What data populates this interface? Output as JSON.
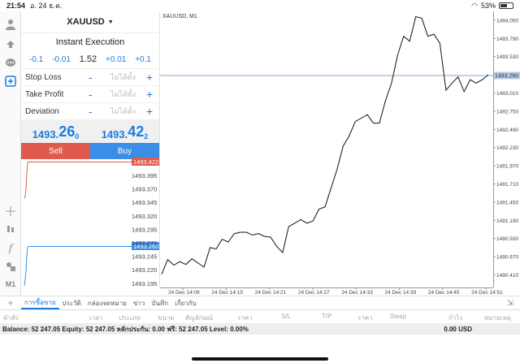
{
  "status_bar": {
    "time": "21:54",
    "date": "อ. 24 ธ.ค.",
    "battery": "53%"
  },
  "order": {
    "symbol": "XAUUSD",
    "execution": "Instant Execution",
    "volume": {
      "m1": "-0.1",
      "m2": "-0.01",
      "value": "1.52",
      "p1": "+0.01",
      "p2": "+0.1"
    },
    "stop_loss": {
      "label": "Stop Loss",
      "placeholder": "ไม่ได้ตั้ง"
    },
    "take_profit": {
      "label": "Take Profit",
      "placeholder": "ไม่ได้ตั้ง"
    },
    "deviation": {
      "label": "Deviation",
      "placeholder": "ไม่ได้ตั้ง"
    },
    "minus": "-",
    "plus": "+",
    "bid": {
      "small": "1493.",
      "big": "26",
      "sup": "0"
    },
    "ask": {
      "small": "1493.",
      "big": "42",
      "sup": "2"
    },
    "sell_label": "Sell",
    "buy_label": "Buy"
  },
  "mini_chart": {
    "ask_label": "1493.422",
    "bid_label": "1493.260",
    "axis_labels": [
      "1493.395",
      "1493.370",
      "1493.345",
      "1493.320",
      "1493.295",
      "1493.270",
      "1493.245",
      "1493.220",
      "1493.195"
    ]
  },
  "toolbar_bottom_label": "M1",
  "chart_data": {
    "type": "line",
    "title": "XAUUSD, M1",
    "y_ticks": [
      "1494.050",
      "1493.790",
      "1493.530",
      "1493.270",
      "1493.010",
      "1492.750",
      "1492.490",
      "1492.230",
      "1491.970",
      "1491.710",
      "1491.450",
      "1491.190",
      "1490.930",
      "1490.670",
      "1490.410"
    ],
    "x_ticks": [
      "24 Dec 14:09",
      "24 Dec 14:15",
      "24 Dec 14:21",
      "24 Dec 14:27",
      "24 Dec 14:33",
      "24 Dec 14:39",
      "24 Dec 14:45",
      "24 Dec 14:51"
    ],
    "current_price": 1493.26,
    "current_label": "1493.260",
    "ylim": [
      1490.3,
      1494.13
    ],
    "values": [
      1490.42,
      1490.63,
      1490.55,
      1490.6,
      1490.56,
      1490.64,
      1490.58,
      1490.52,
      1490.8,
      1490.78,
      1490.92,
      1490.88,
      1491.0,
      1491.02,
      1491.02,
      1490.98,
      1491.0,
      1490.96,
      1490.95,
      1490.82,
      1490.73,
      1491.1,
      1491.15,
      1491.2,
      1491.15,
      1491.18,
      1491.35,
      1491.38,
      1491.65,
      1491.92,
      1492.25,
      1492.4,
      1492.6,
      1492.65,
      1492.7,
      1492.58,
      1492.58,
      1492.9,
      1493.15,
      1493.55,
      1493.82,
      1493.75,
      1494.1,
      1494.08,
      1493.82,
      1493.85,
      1493.72,
      1493.05,
      1493.15,
      1493.24,
      1493.03,
      1493.2,
      1493.15,
      1493.2,
      1493.27
    ]
  },
  "tabs": {
    "plus": "+",
    "items": [
      "การซื้อขาย",
      "ประวัติ",
      "กล่องจดหมาย",
      "ข่าว",
      "บันทึก",
      "เกี่ยวกับ"
    ],
    "expand": "⇲"
  },
  "columns": [
    "คำสั่ง",
    "เวลา",
    "ประเภท",
    "ขนาด",
    "สัญลักษณ์",
    "ราคา",
    "S/L",
    "T/P",
    "ราคา",
    "Swap",
    "กำไร",
    "หมายเหตุ"
  ],
  "balance": {
    "text": "Balance: 52 247.05 Equity: 52 247.05 หลักประกัน: 0.00 ฟรี: 52 247.05 Level: 0.00%",
    "total": "0.00  USD"
  },
  "colors": {
    "accent": "#1a7de0",
    "sell": "#e05a4e",
    "buy": "#3a8ee6",
    "ask_line": "#e05a4e",
    "bid_line": "#3a8ee6"
  }
}
